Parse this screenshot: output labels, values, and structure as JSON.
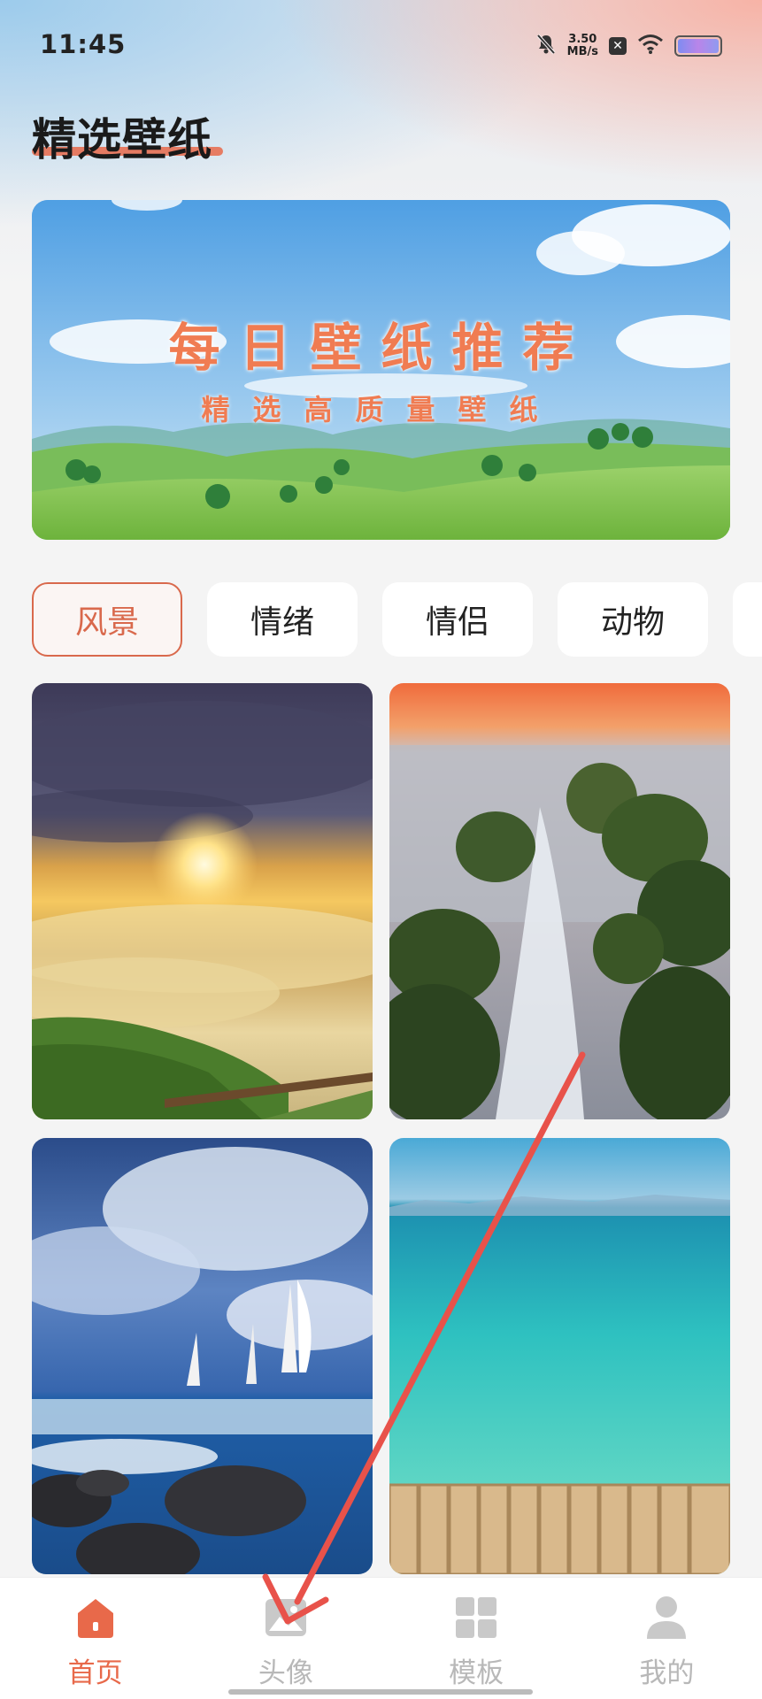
{
  "status_bar": {
    "time": "11:45",
    "speed_value": "3.50",
    "speed_unit": "MB/s",
    "icons": [
      "mute-bell-icon",
      "x-app-icon",
      "wifi-icon",
      "battery-icon"
    ]
  },
  "header": {
    "title": "精选壁纸",
    "accent": "#e8694a"
  },
  "banner": {
    "title": "每日壁纸推荐",
    "subtitle": "精选高质量壁纸"
  },
  "categories": [
    {
      "label": "风景",
      "active": true
    },
    {
      "label": "情绪",
      "active": false
    },
    {
      "label": "情侣",
      "active": false
    },
    {
      "label": "动物",
      "active": false
    }
  ],
  "wallpapers": [
    {
      "subject": "sunset-above-clouds"
    },
    {
      "subject": "waterfall-mossy-rocks"
    },
    {
      "subject": "sailboats-stormy-sea"
    },
    {
      "subject": "turquoise-water-pier"
    }
  ],
  "bottom_nav": [
    {
      "label": "首页",
      "icon": "home-icon",
      "active": true
    },
    {
      "label": "头像",
      "icon": "image-icon",
      "active": false
    },
    {
      "label": "模板",
      "icon": "grid-icon",
      "active": false
    },
    {
      "label": "我的",
      "icon": "user-icon",
      "active": false
    }
  ],
  "colors": {
    "accent": "#e8694a",
    "inactive": "#b8b8b8",
    "annotation_arrow": "#e8524a"
  }
}
